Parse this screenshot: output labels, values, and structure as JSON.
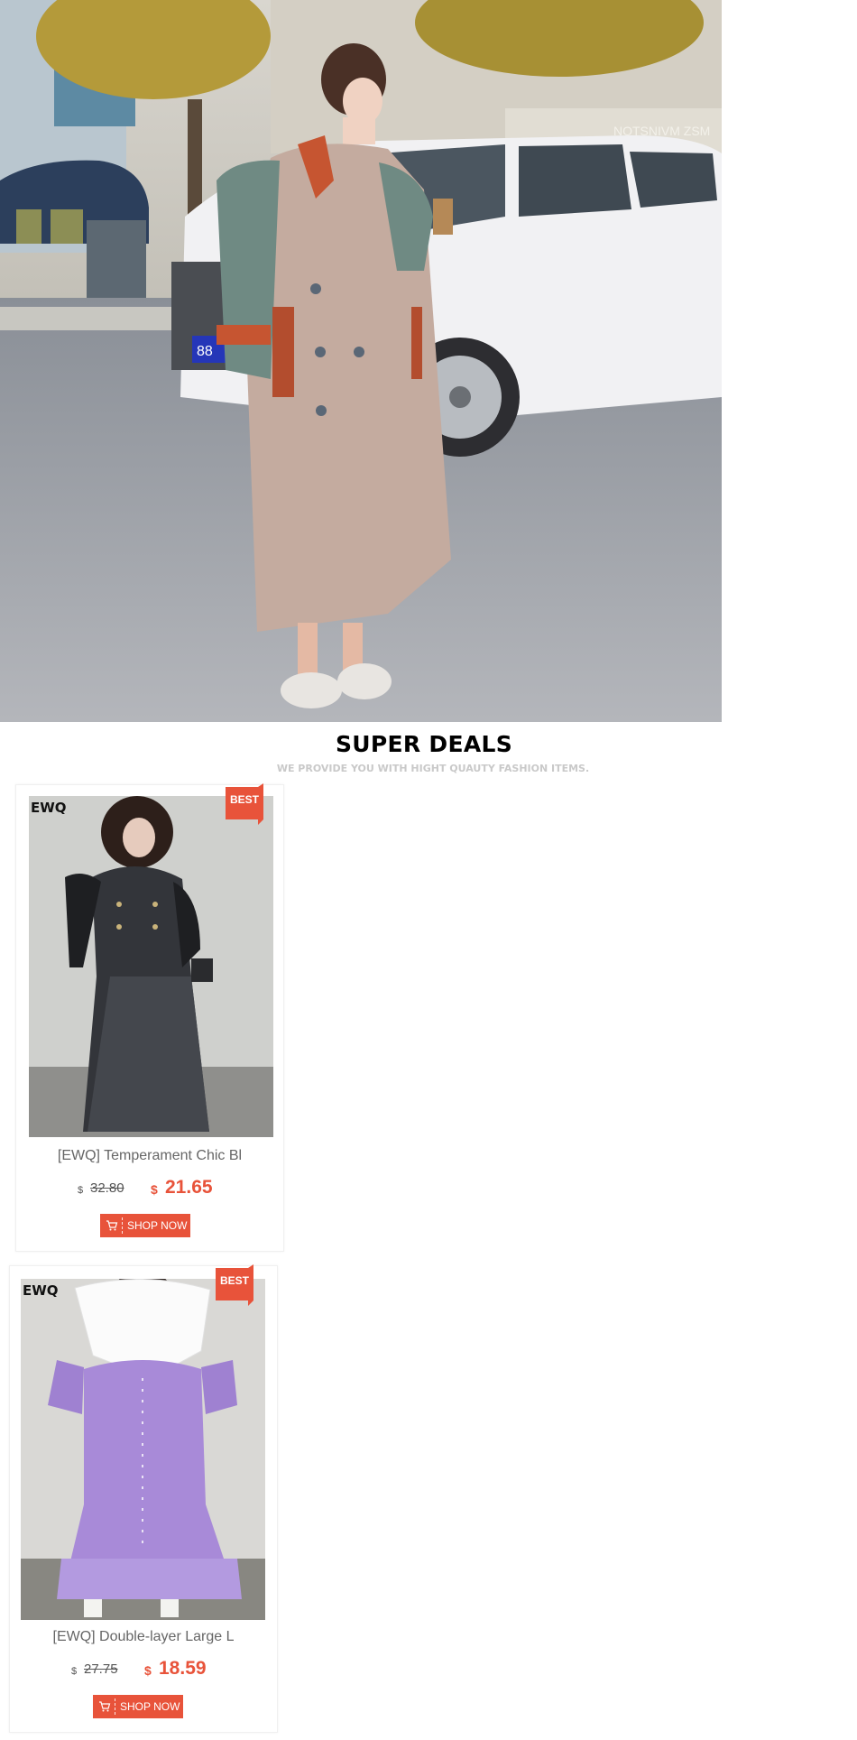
{
  "hero": {
    "storefront_sign": "NOTSNIVM ZSM",
    "plate_text": "88"
  },
  "section": {
    "title": "SUPER DEALS",
    "subtitle": "WE PROVIDE YOU WITH HIGHT QUAUTY FASHION ITEMS."
  },
  "products": [
    {
      "brand": "EWQ",
      "badge": "BEST",
      "name": "[EWQ] Temperament Chic Bl",
      "currency": "$",
      "old_price": "32.80",
      "new_price": "21.65",
      "button_label": "SHOP NOW"
    },
    {
      "brand": "EWQ",
      "badge": "BEST",
      "name": "[EWQ] Double-layer Large L",
      "currency": "$",
      "old_price": "27.75",
      "new_price": "18.59",
      "button_label": "SHOP NOW"
    }
  ],
  "colors": {
    "accent": "#e8533a",
    "muted_text": "#666666",
    "subtitle_gray": "#c9c9c9"
  }
}
